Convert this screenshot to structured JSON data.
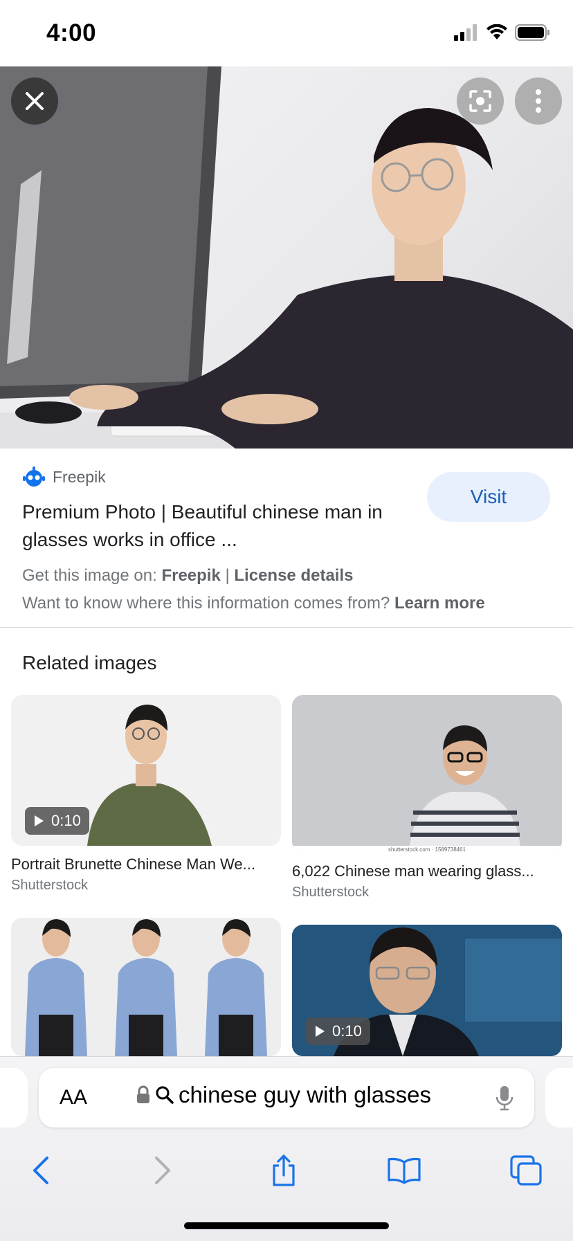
{
  "status": {
    "time": "4:00"
  },
  "hero": {
    "close_icon": "close-icon",
    "lens_icon": "lens-icon",
    "more_icon": "more-vertical-icon"
  },
  "result": {
    "source": "Freepik",
    "title": "Premium Photo | Beautiful chinese man in glasses works in office ...",
    "visit_label": "Visit",
    "get_prefix": "Get this image on: ",
    "get_source": "Freepik",
    "separator": " | ",
    "license": "License details",
    "want_prefix": "Want to know where this information comes from? ",
    "learn_more": "Learn more"
  },
  "related": {
    "heading": "Related images",
    "items": [
      {
        "title": "Portrait Brunette Chinese Man We...",
        "source": "Shutterstock",
        "duration": "0:10"
      },
      {
        "title": "6,022 Chinese man wearing glass...",
        "source": "Shutterstock",
        "watermark": "shutterstock.com · 1589738461"
      },
      {
        "title": "",
        "source": ""
      },
      {
        "title": "",
        "source": "",
        "duration": "0:10"
      }
    ]
  },
  "browser": {
    "aa_label": "AA",
    "url_text": "chinese guy with glasses"
  },
  "colors": {
    "accent": "#1a5fb4",
    "visit_bg": "#e8f0fe"
  }
}
